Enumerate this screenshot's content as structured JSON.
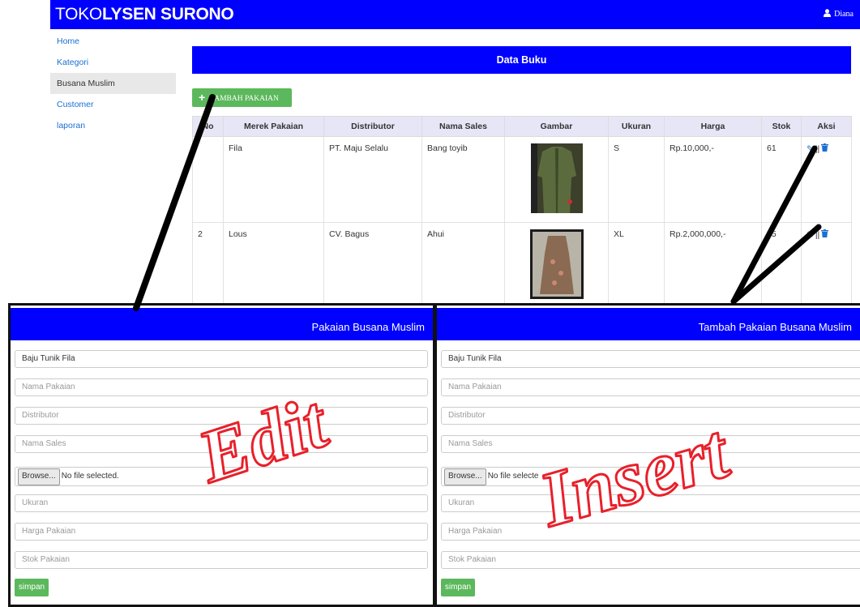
{
  "app": {
    "brand_light": "TOKO",
    "brand_bold": "LYSEN SURONO",
    "user": "Diana"
  },
  "sidebar": {
    "items": [
      {
        "label": "Home"
      },
      {
        "label": "Kategori"
      },
      {
        "label": "Busana Muslim",
        "active": true
      },
      {
        "label": "Customer"
      },
      {
        "label": "laporan"
      }
    ]
  },
  "main": {
    "title": "Data Buku",
    "add_button": "TAMBAH  PAKAIAN",
    "table": {
      "headers": [
        "No",
        "Merek Pakaian",
        "Distributor",
        "Nama Sales",
        "Gambar",
        "Ukuran",
        "Harga",
        "Stok",
        "Aksi"
      ],
      "rows": [
        {
          "no": "",
          "merek": "Fila",
          "distributor": "PT. Maju Selalu",
          "sales": "Bang toyib",
          "ukuran": "S",
          "harga": "Rp.10,000,-",
          "stok": "61"
        },
        {
          "no": "2",
          "merek": "Lous",
          "distributor": "CV. Bagus",
          "sales": "Ahui",
          "ukuran": "XL",
          "harga": "Rp.2,000,000,-",
          "stok": "55"
        }
      ]
    }
  },
  "edit_form": {
    "title": "Pakaian Busana Muslim",
    "field_category": "Baju Tunik Fila",
    "ph_nama": "Nama Pakaian",
    "ph_distributor": "Distributor",
    "ph_sales": "Nama Sales",
    "browse": "Browse...",
    "no_file": "No file selected.",
    "ph_ukuran": "Ukuran",
    "ph_harga": "Harga Pakaian",
    "ph_stok": "Stok Pakaian",
    "save": "simpan"
  },
  "insert_form": {
    "title": "Tambah Pakaian Busana Muslim",
    "field_category": "Baju Tunik Fila",
    "ph_nama": "Nama Pakaian",
    "ph_distributor": "Distributor",
    "ph_sales": "Nama Sales",
    "browse": "Browse...",
    "no_file": "No file selecte",
    "ph_ukuran": "Ukuran",
    "ph_harga": "Harga Pakaian",
    "ph_stok": "Stok Pakaian",
    "save": "simpan"
  },
  "annotations": {
    "edit": "Edit",
    "insert": "Insert",
    "color": "#e8202a"
  }
}
